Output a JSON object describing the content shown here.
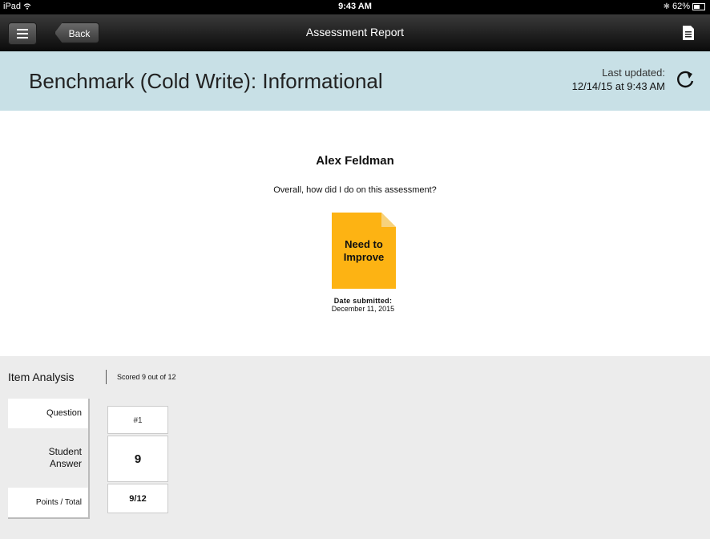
{
  "status_bar": {
    "device": "iPad",
    "time": "9:43 AM",
    "battery": "62%",
    "battery_level": 0.62
  },
  "nav": {
    "back_label": "Back",
    "title": "Assessment Report"
  },
  "header": {
    "title": "Benchmark (Cold Write): Informational",
    "last_updated_label": "Last updated:",
    "last_updated_value": "12/14/15 at 9:43 AM"
  },
  "report": {
    "student_name": "Alex Feldman",
    "question": "Overall, how did I do on this assessment?",
    "result_line1": "Need to",
    "result_line2": "Improve",
    "result_color": "#fdb313",
    "date_label": "Date submitted:",
    "date_value": "December 11, 2015"
  },
  "item_analysis": {
    "title": "Item Analysis",
    "score": "Scored 9 out of 12",
    "row_labels": {
      "question": "Question",
      "student_answer_1": "Student",
      "student_answer_2": "Answer",
      "points": "Points / Total"
    },
    "columns": [
      {
        "question": "#1",
        "answer": "9",
        "points": "9/12"
      }
    ]
  },
  "colors": {
    "header_band": "#c8e0e6",
    "analysis_bg": "#ececec"
  }
}
